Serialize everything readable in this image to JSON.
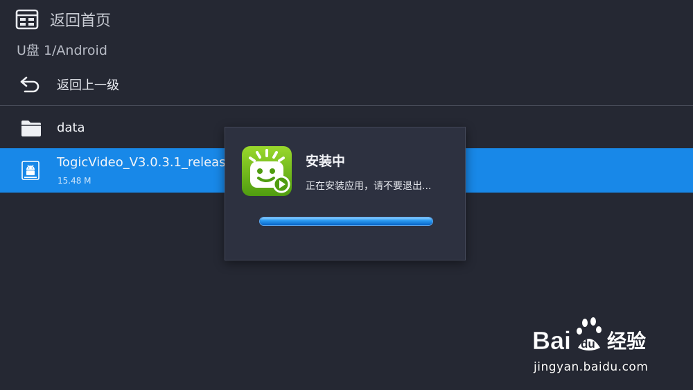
{
  "header": {
    "home_label": "返回首页",
    "home_icon": "file-manager-icon",
    "path": "U盘 1/Android"
  },
  "navigation": {
    "back_label": "返回上一级",
    "back_icon": "back-arrow-icon"
  },
  "files": [
    {
      "name": "data",
      "icon": "folder-icon",
      "selected": false
    },
    {
      "name": "TogicVideo_V3.0.3.1_release_",
      "size": "15.48 M",
      "icon": "android-apk-icon",
      "selected": true
    }
  ],
  "dialog": {
    "title": "安装中",
    "message": "正在安装应用，请不要退出...",
    "app_icon": "togic-video-app-icon",
    "progress": 1.0
  },
  "watermark": {
    "logo": "Bai du 经验",
    "url": "jingyan.baidu.com"
  },
  "colors": {
    "background": "#252833",
    "selection": "#1888e8",
    "dialog_background": "#2d3140",
    "progress": "#2a9af2"
  }
}
